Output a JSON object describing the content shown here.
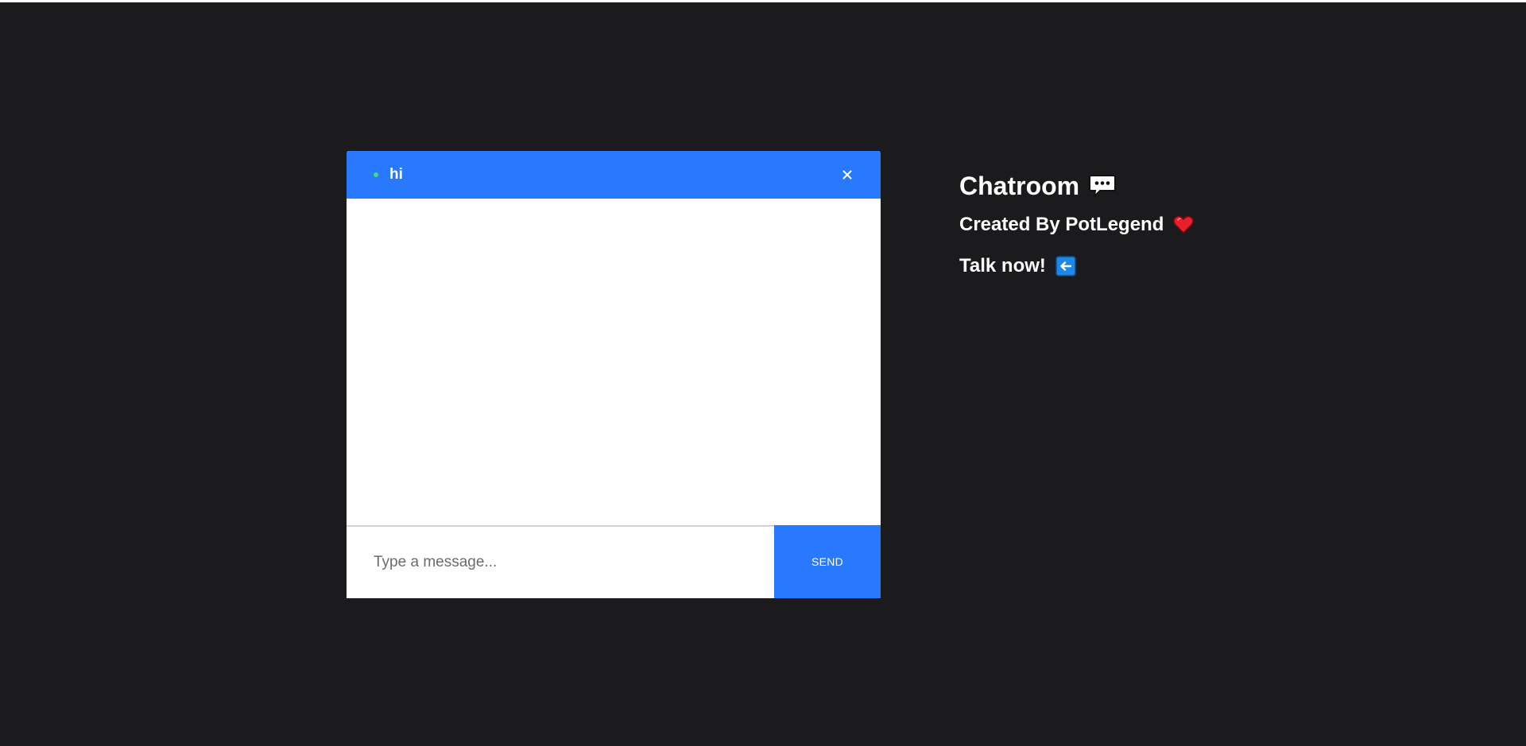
{
  "chat": {
    "room_name": "hi",
    "status_color": "#3ddc84",
    "accent_color": "#2979ff",
    "close_icon": "close-icon",
    "input_placeholder": "Type a message...",
    "input_value": "",
    "send_label": "SEND"
  },
  "info": {
    "title": "Chatroom",
    "title_icon": "speech-bubble-icon",
    "subtitle": "Created By PotLegend",
    "subtitle_icon": "heart-icon",
    "cta": "Talk now!",
    "cta_icon": "left-arrow-icon"
  }
}
